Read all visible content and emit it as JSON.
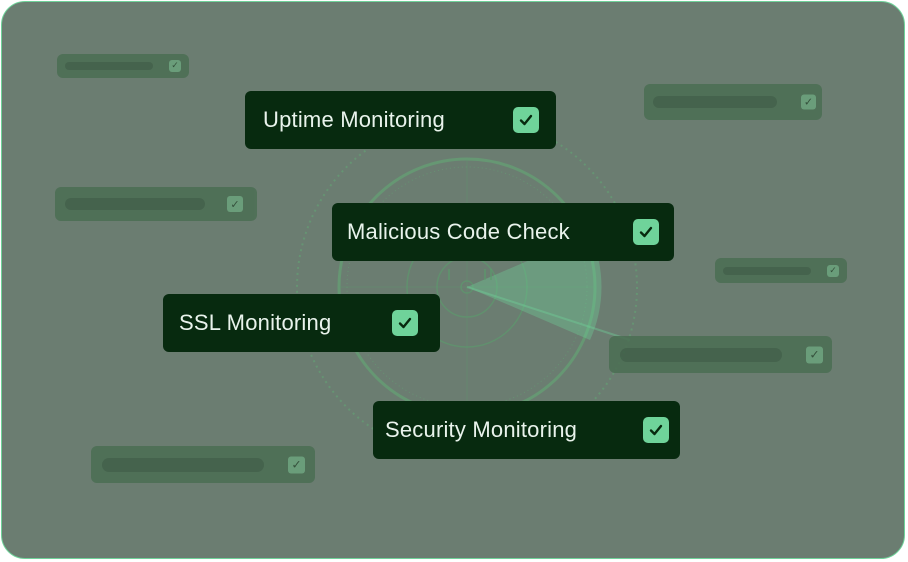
{
  "features": [
    {
      "label": "Uptime Monitoring",
      "checked": true
    },
    {
      "label": "Malicious Code Check",
      "checked": true
    },
    {
      "label": "SSL Monitoring",
      "checked": true
    },
    {
      "label": "Security Monitoring",
      "checked": true
    }
  ],
  "colors": {
    "panel": "#6b7d71",
    "chip_bg": "#072a0f",
    "accent": "#6fd39a",
    "text": "#e9f3ec"
  },
  "icons": {
    "check": "check-icon",
    "radar": "radar-icon"
  }
}
